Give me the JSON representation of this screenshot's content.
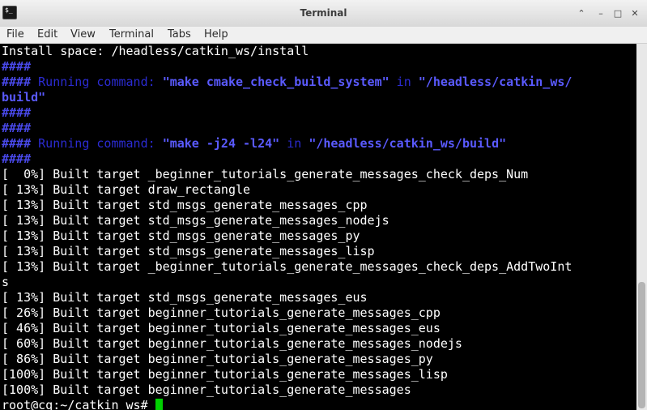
{
  "window": {
    "title": "Terminal",
    "icon": "terminal-icon"
  },
  "window_buttons": {
    "menu": "⌃",
    "minimize": "–",
    "maximize": "□",
    "close": "✕"
  },
  "menubar": [
    "File",
    "Edit",
    "View",
    "Terminal",
    "Tabs",
    "Help"
  ],
  "colors": {
    "hash_blue": "#4848e8",
    "running_dim": "#2b2bd2",
    "command_blue": "#5a5aff",
    "cursor_green": "#00d000"
  },
  "terminal": {
    "header": {
      "install_line": "Install space: /headless/catkin_ws/install",
      "hash1": "####",
      "run1_hash": "####",
      "run1_label": " Running command: ",
      "run1_cmd": "\"make cmake_check_build_system\"",
      "run1_in": " in ",
      "run1_path": "\"/headless/catkin_ws/",
      "run1_path_cont": "build\"",
      "hash2": "####",
      "hash3": "####",
      "run2_hash": "####",
      "run2_label": " Running command: ",
      "run2_cmd": "\"make -j24 -l24\"",
      "run2_in": " in ",
      "run2_path": "\"/headless/catkin_ws/build\"",
      "hash4": "####"
    },
    "build_lines": [
      "[  0%] Built target _beginner_tutorials_generate_messages_check_deps_Num",
      "[ 13%] Built target draw_rectangle",
      "[ 13%] Built target std_msgs_generate_messages_cpp",
      "[ 13%] Built target std_msgs_generate_messages_nodejs",
      "[ 13%] Built target std_msgs_generate_messages_py",
      "[ 13%] Built target std_msgs_generate_messages_lisp",
      "[ 13%] Built target _beginner_tutorials_generate_messages_check_deps_AddTwoInt",
      "s",
      "[ 13%] Built target std_msgs_generate_messages_eus",
      "[ 26%] Built target beginner_tutorials_generate_messages_cpp",
      "[ 46%] Built target beginner_tutorials_generate_messages_eus",
      "[ 60%] Built target beginner_tutorials_generate_messages_nodejs",
      "[ 86%] Built target beginner_tutorials_generate_messages_py",
      "[100%] Built target beginner_tutorials_generate_messages_lisp",
      "[100%] Built target beginner_tutorials_generate_messages"
    ],
    "prompt": "root@cq:~/catkin_ws# "
  }
}
